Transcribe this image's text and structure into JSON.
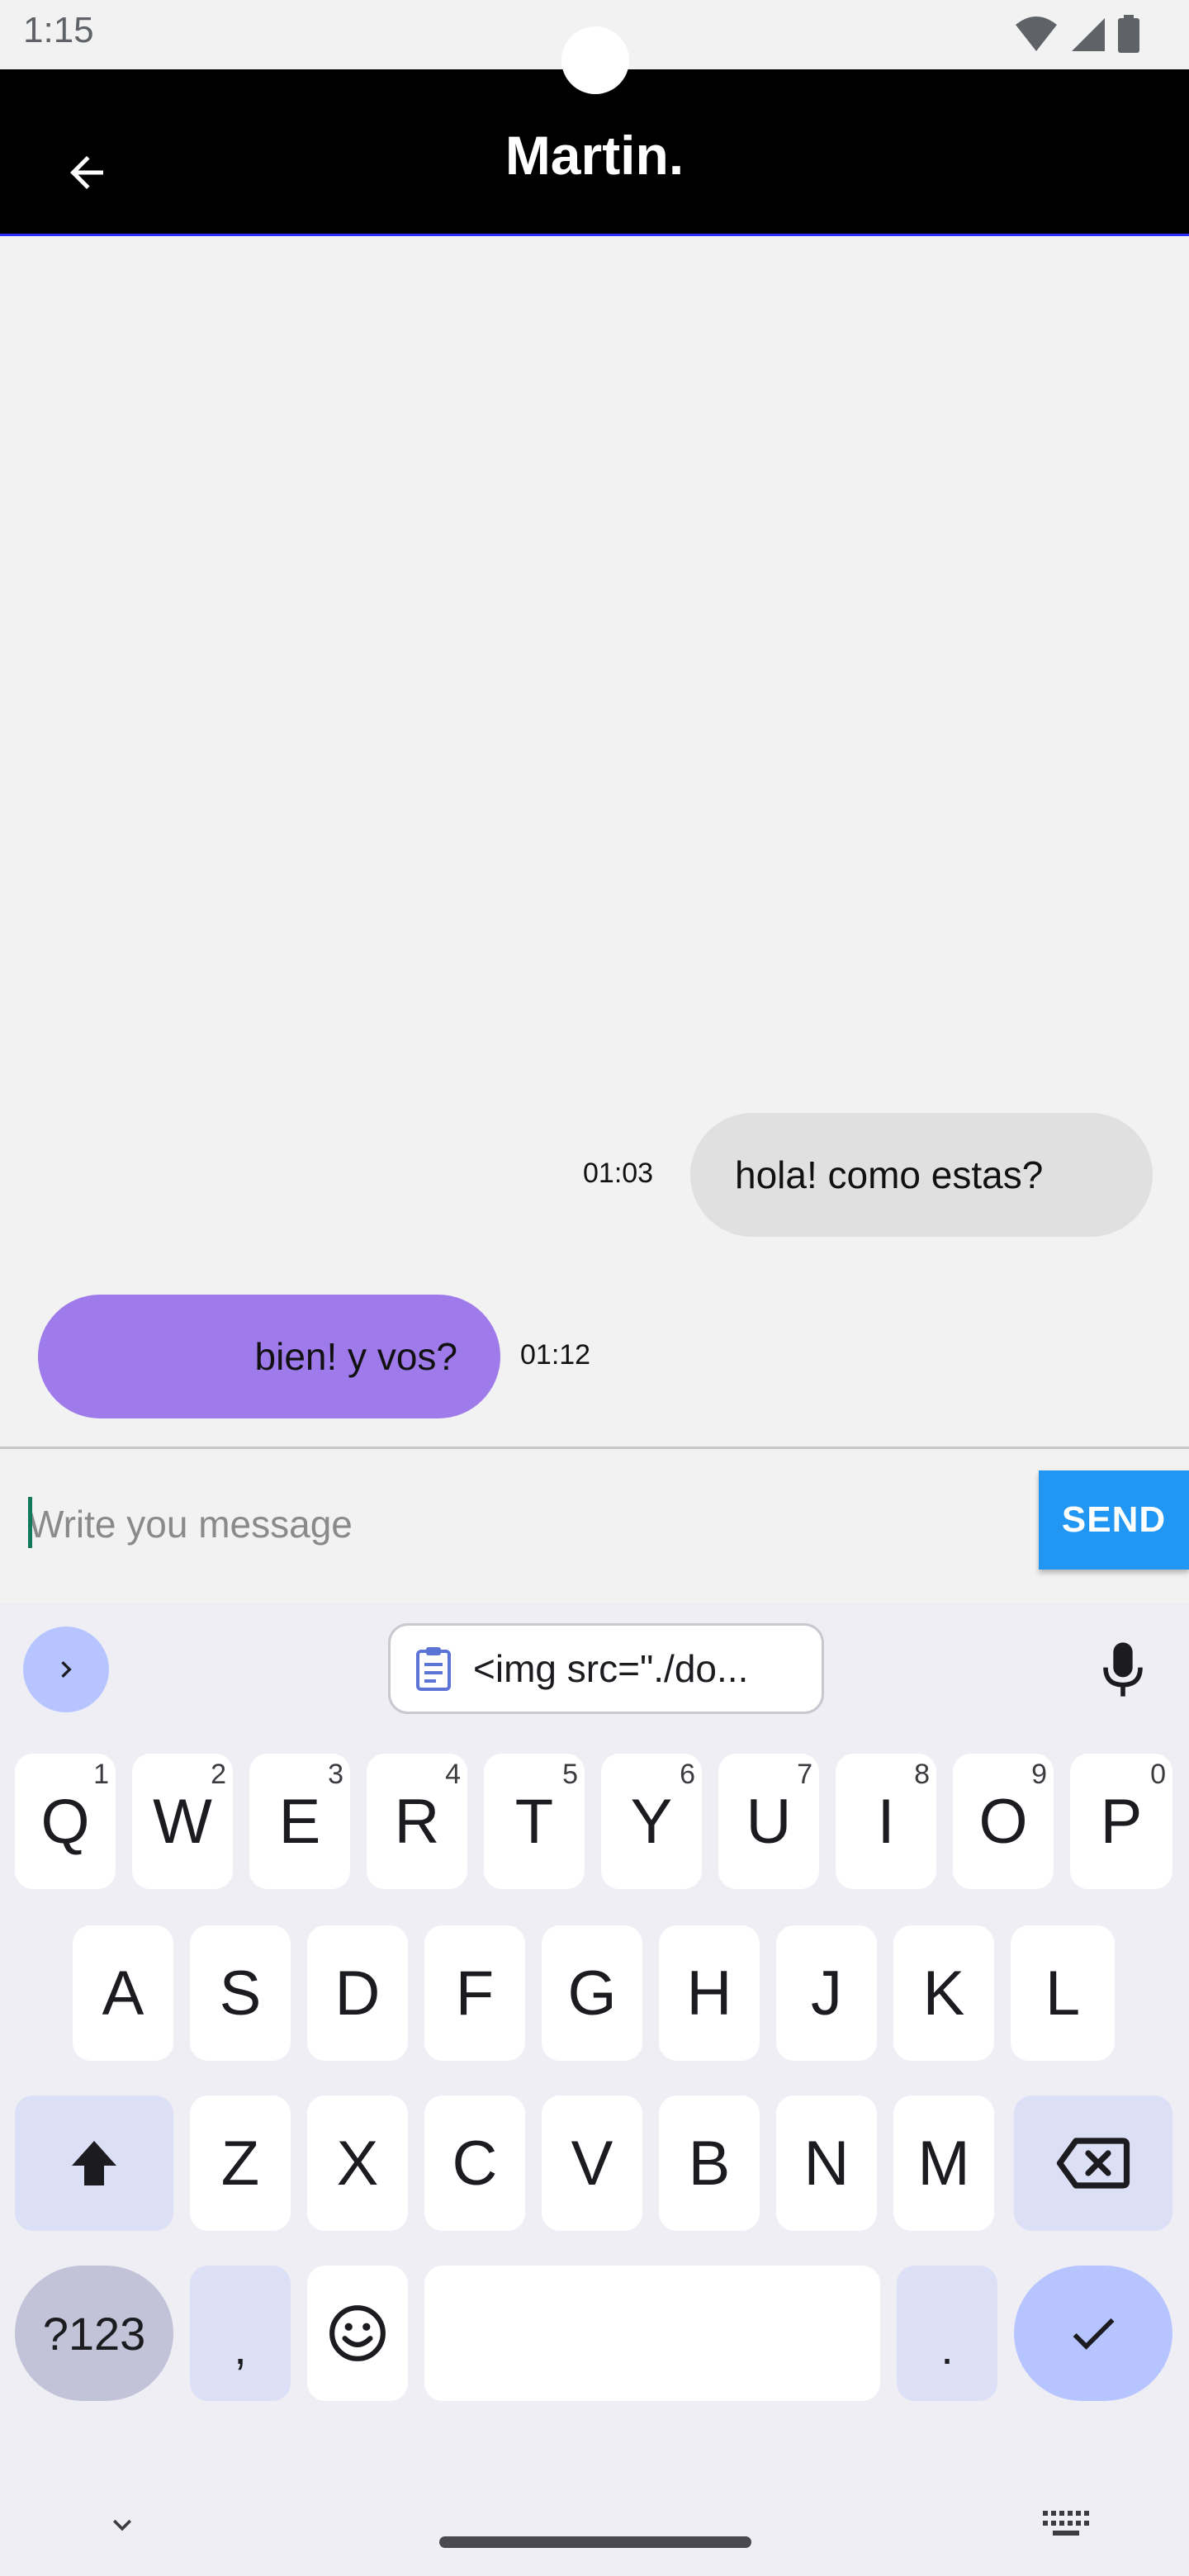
{
  "status_bar": {
    "time": "1:15",
    "icons": [
      "wifi-icon",
      "signal-icon",
      "battery-icon"
    ]
  },
  "app_bar": {
    "title": "Martin.",
    "back_icon": "arrow-back-icon",
    "background": "#000000"
  },
  "messages": [
    {
      "direction": "sent",
      "text": "hola! como estas?",
      "time": "01:03",
      "color": "#e0e0e0"
    },
    {
      "direction": "received",
      "text": "bien! y vos?",
      "time": "01:12",
      "color": "#9f7aeb"
    }
  ],
  "composer": {
    "placeholder": "Write you message",
    "value": "",
    "send_label": "SEND",
    "send_color": "#2196f3"
  },
  "keyboard": {
    "clipboard_chip": "<img src=\"./do...",
    "row1": [
      {
        "key": "Q",
        "hint": "1"
      },
      {
        "key": "W",
        "hint": "2"
      },
      {
        "key": "E",
        "hint": "3"
      },
      {
        "key": "R",
        "hint": "4"
      },
      {
        "key": "T",
        "hint": "5"
      },
      {
        "key": "Y",
        "hint": "6"
      },
      {
        "key": "U",
        "hint": "7"
      },
      {
        "key": "I",
        "hint": "8"
      },
      {
        "key": "O",
        "hint": "9"
      },
      {
        "key": "P",
        "hint": "0"
      }
    ],
    "row2": [
      "A",
      "S",
      "D",
      "F",
      "G",
      "H",
      "J",
      "K",
      "L"
    ],
    "row3": [
      "Z",
      "X",
      "C",
      "V",
      "B",
      "N",
      "M"
    ],
    "symbols_label": "?123",
    "comma_label": ",",
    "period_label": ".",
    "accent_color": "#b6c4ff"
  }
}
